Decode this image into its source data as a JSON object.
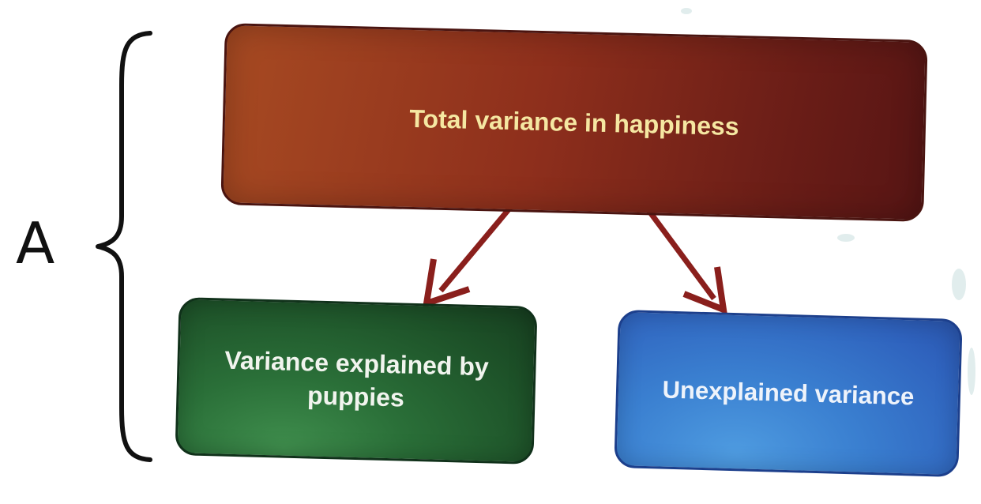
{
  "side_label": "A",
  "nodes": {
    "top": "Total variance in happiness",
    "left": "Variance explained by puppies",
    "right": "Unexplained variance"
  },
  "colors": {
    "top_box": "#8e2f1c",
    "top_text": "#f5e7a2",
    "left_box": "#1d5128",
    "right_box": "#3a7fd0",
    "arrow": "#8a1f1c",
    "brace": "#111111"
  }
}
